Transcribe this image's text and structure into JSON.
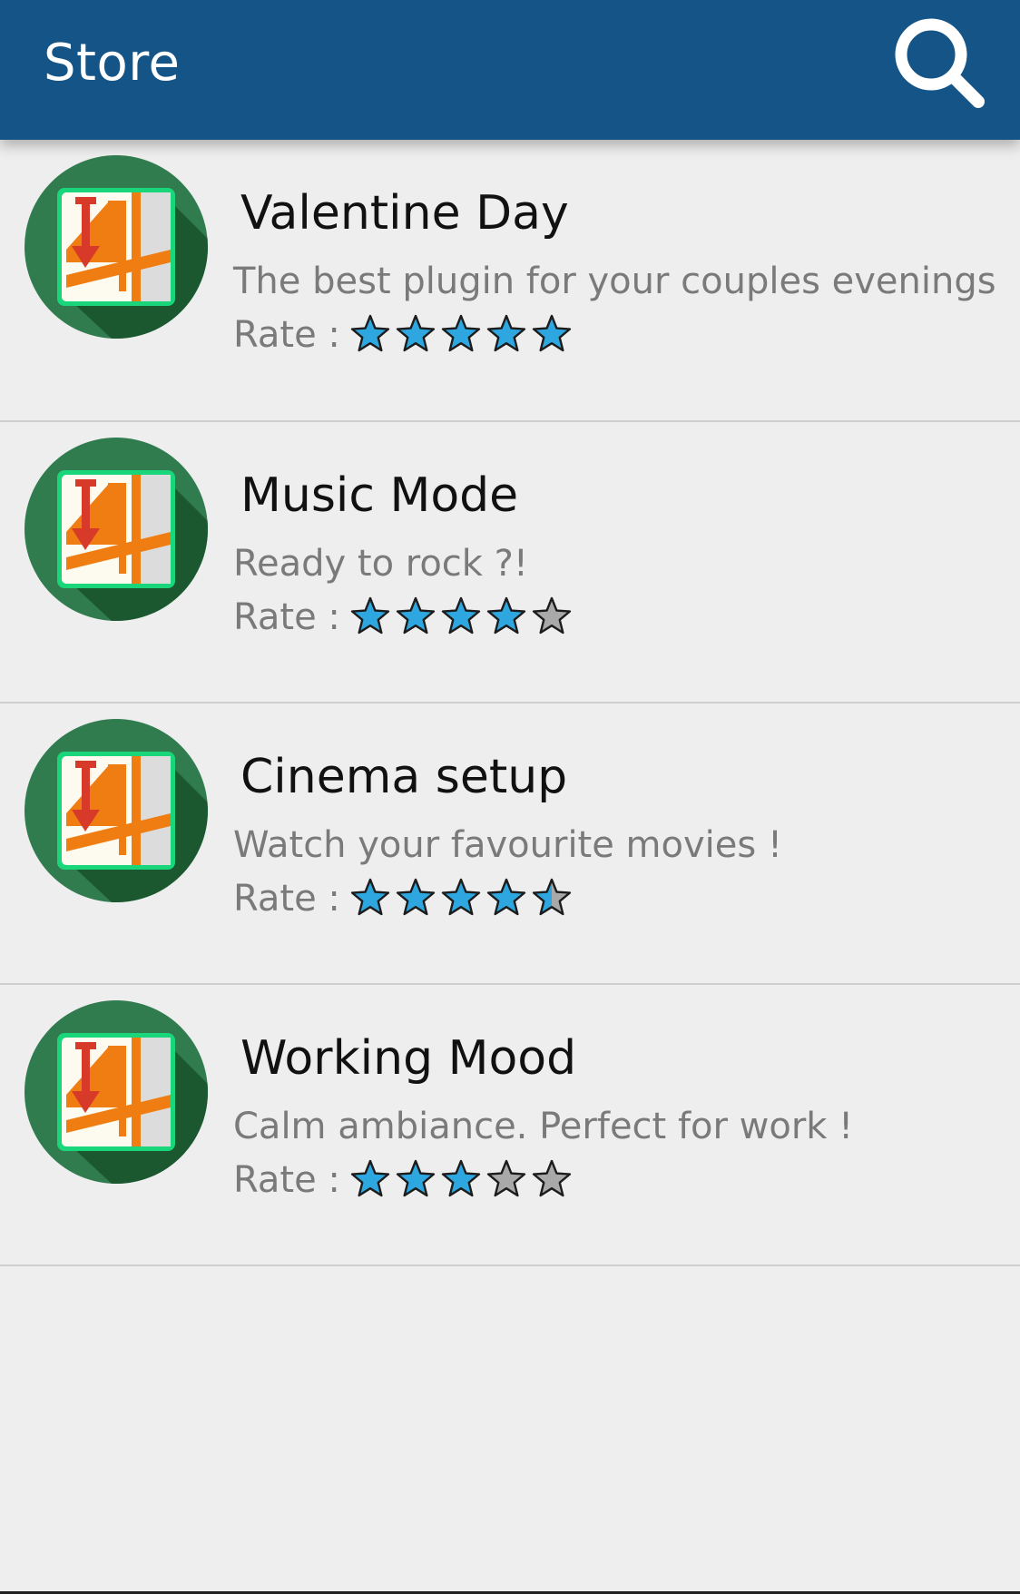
{
  "appbar": {
    "title": "Store",
    "search_icon": "search-icon",
    "background": "#145487"
  },
  "colors": {
    "star_filled": "#2ea7e0",
    "star_empty": "#a9a9a9",
    "star_outline": "#1c1c1c",
    "avatar_green": "#317c4f",
    "avatar_shadow": "#1b5830",
    "icon_orange": "#f07d12",
    "icon_red": "#d83a2a"
  },
  "rate_label": "Rate :",
  "items": [
    {
      "title": "Valentine Day",
      "description": "The best plugin for your couples evenings",
      "icon": "plugin-app-icon",
      "rating": 5,
      "max_rating": 5
    },
    {
      "title": "Music Mode",
      "description": "Ready to rock ?!",
      "icon": "plugin-app-icon",
      "rating": 4,
      "max_rating": 5
    },
    {
      "title": "Cinema setup",
      "description": "Watch your favourite movies !",
      "icon": "plugin-app-icon",
      "rating": 4.5,
      "max_rating": 5
    },
    {
      "title": "Working Mood",
      "description": "Calm ambiance. Perfect for work !",
      "icon": "plugin-app-icon",
      "rating": 3,
      "max_rating": 5
    }
  ]
}
